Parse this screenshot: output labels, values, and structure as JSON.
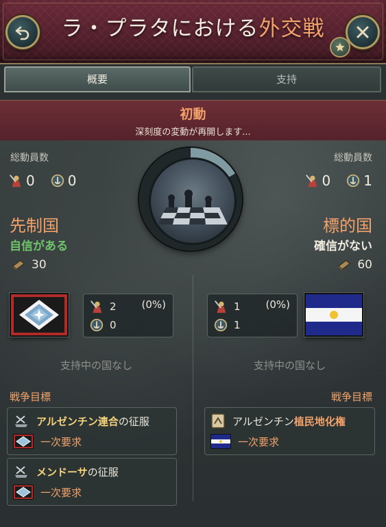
{
  "header": {
    "title_prefix": "ラ・プラタにおける",
    "title_highlight": "外交戦"
  },
  "tabs": [
    {
      "label": "概要",
      "active": true
    },
    {
      "label": "支持",
      "active": false
    }
  ],
  "status": {
    "title": "初動",
    "subtitle": "深刻度の変動が再開します..."
  },
  "attacker": {
    "mobilization_label": "総動員数",
    "army_count": "0",
    "navy_count": "0",
    "role": "先制国",
    "confidence": "自信がある",
    "score": "30",
    "stats": {
      "army": "2",
      "army_pct": "(0%)",
      "navy": "0"
    },
    "supporters": "支持中の国なし",
    "war_goals_label": "戦争目標",
    "war_goals": [
      {
        "target": "アルゼンチン連合",
        "suffix": "の征服",
        "demand": "一次要求"
      },
      {
        "target": "メンドーサ",
        "suffix": "の征服",
        "demand": "一次要求"
      }
    ]
  },
  "defender": {
    "mobilization_label": "総動員数",
    "army_count": "0",
    "navy_count": "1",
    "role": "標的国",
    "confidence": "確信がない",
    "score": "60",
    "stats": {
      "army": "1",
      "army_pct": "(0%)",
      "navy": "1"
    },
    "supporters": "支持中の国なし",
    "war_goals_label": "戦争目標",
    "war_goals": [
      {
        "prefix": "アルゼンチン",
        "target": "植民地化権",
        "demand": "一次要求"
      }
    ]
  },
  "colors": {
    "accent_orange": "#f2a26a",
    "confident_green": "#6fc36a",
    "header_crimson": "#5a2330",
    "gold_border": "#b29a64"
  },
  "icons": [
    "back-arrow-icon",
    "close-x-icon",
    "star-icon",
    "army-icon",
    "navy-icon",
    "score-icon",
    "chessboard-image",
    "conquest-icon",
    "colonization-icon"
  ]
}
